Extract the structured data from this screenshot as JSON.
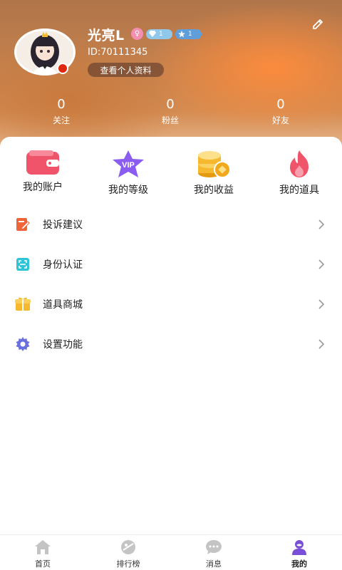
{
  "header": {
    "username": "光亮L",
    "gender_symbol": "♀",
    "diamond_level": "1",
    "star_level": "1",
    "user_id": "ID:70111345",
    "profile_button": "查看个人资料"
  },
  "stats": [
    {
      "value": "0",
      "label": "关注"
    },
    {
      "value": "0",
      "label": "粉丝"
    },
    {
      "value": "0",
      "label": "好友"
    }
  ],
  "quick_actions": [
    {
      "label": "我的账户",
      "icon": "wallet-icon"
    },
    {
      "label": "我的等级",
      "icon": "vip-star-icon"
    },
    {
      "label": "我的收益",
      "icon": "coins-icon"
    },
    {
      "label": "我的道具",
      "icon": "flame-icon"
    }
  ],
  "menu": [
    {
      "label": "投诉建议",
      "icon": "complaint-icon"
    },
    {
      "label": "身份认证",
      "icon": "id-scan-icon"
    },
    {
      "label": "道具商城",
      "icon": "gift-shop-icon"
    },
    {
      "label": "设置功能",
      "icon": "gear-icon"
    }
  ],
  "tabbar": [
    {
      "label": "首页",
      "icon": "home-icon"
    },
    {
      "label": "排行榜",
      "icon": "ranking-icon"
    },
    {
      "label": "消息",
      "icon": "message-icon"
    },
    {
      "label": "我的",
      "icon": "profile-icon",
      "active": true
    }
  ],
  "colors": {
    "wallet": "#f0546a",
    "vip": "#8a5cf0",
    "coins": "#f5b82e",
    "flame": "#f0546a",
    "complaint": "#f0643a",
    "id_scan": "#2fc3d8",
    "gift_shop": "#f5b82e",
    "settings": "#6a6fe0",
    "tab_active": "#7a4fd8"
  }
}
